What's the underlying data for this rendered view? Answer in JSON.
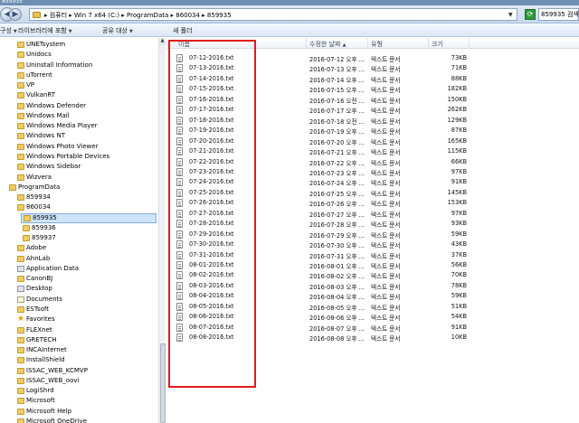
{
  "window": {
    "title": "859935"
  },
  "address": {
    "path": "▸ 컴퓨터 ▸ Win 7 x64 (C:) ▸ ProgramData ▸ 860034 ▸ 859935",
    "search_value": "859935 검색"
  },
  "toolbar": {
    "organize": "구성",
    "include_library": "라이브러리에 포함",
    "share_with": "공유 대상",
    "new_folder": "새 폴더"
  },
  "nav_items": [
    {
      "label": "UNETsystem",
      "indent": 1,
      "icon": "folder"
    },
    {
      "label": "Unidocs",
      "indent": 1,
      "icon": "folder"
    },
    {
      "label": "Uninstall Information",
      "indent": 1,
      "icon": "folder"
    },
    {
      "label": "uTorrent",
      "indent": 1,
      "icon": "folder"
    },
    {
      "label": "VP",
      "indent": 1,
      "icon": "folder"
    },
    {
      "label": "VulkanRT",
      "indent": 1,
      "icon": "folder"
    },
    {
      "label": "Windows Defender",
      "indent": 1,
      "icon": "folder"
    },
    {
      "label": "Windows Mail",
      "indent": 1,
      "icon": "folder"
    },
    {
      "label": "Windows Media Player",
      "indent": 1,
      "icon": "folder"
    },
    {
      "label": "Windows NT",
      "indent": 1,
      "icon": "folder"
    },
    {
      "label": "Windows Photo Viewer",
      "indent": 1,
      "icon": "folder"
    },
    {
      "label": "Windows Portable Devices",
      "indent": 1,
      "icon": "folder"
    },
    {
      "label": "Windows Sidebar",
      "indent": 1,
      "icon": "folder"
    },
    {
      "label": "Wizvera",
      "indent": 1,
      "icon": "folder"
    },
    {
      "label": "ProgramData",
      "indent": 0,
      "icon": "folder"
    },
    {
      "label": "859934",
      "indent": 1,
      "icon": "folder"
    },
    {
      "label": "860034",
      "indent": 1,
      "icon": "folder"
    },
    {
      "label": "859935",
      "indent": 2,
      "icon": "folder",
      "selected": true
    },
    {
      "label": "859936",
      "indent": 2,
      "icon": "folder"
    },
    {
      "label": "859937",
      "indent": 2,
      "icon": "folder"
    },
    {
      "label": "Adobe",
      "indent": 1,
      "icon": "folder"
    },
    {
      "label": "AhnLab",
      "indent": 1,
      "icon": "folder"
    },
    {
      "label": "Application Data",
      "indent": 1,
      "icon": "gear"
    },
    {
      "label": "CanonBJ",
      "indent": 1,
      "icon": "folder"
    },
    {
      "label": "Desktop",
      "indent": 1,
      "icon": "gear"
    },
    {
      "label": "Documents",
      "indent": 1,
      "icon": "docs"
    },
    {
      "label": "ESTsoft",
      "indent": 1,
      "icon": "folder"
    },
    {
      "label": "Favorites",
      "indent": 1,
      "icon": "star"
    },
    {
      "label": "FLEXnet",
      "indent": 1,
      "icon": "folder"
    },
    {
      "label": "GRETECH",
      "indent": 1,
      "icon": "folder"
    },
    {
      "label": "INCAInternet",
      "indent": 1,
      "icon": "folder"
    },
    {
      "label": "InstallShield",
      "indent": 1,
      "icon": "folder"
    },
    {
      "label": "ISSAC_WEB_KCMVP",
      "indent": 1,
      "icon": "folder"
    },
    {
      "label": "ISSAC_WEB_oovi",
      "indent": 1,
      "icon": "folder"
    },
    {
      "label": "LogiShrd",
      "indent": 1,
      "icon": "folder"
    },
    {
      "label": "Microsoft",
      "indent": 1,
      "icon": "folder"
    },
    {
      "label": "Microsoft Help",
      "indent": 1,
      "icon": "folder"
    },
    {
      "label": "Microsoft OneDrive",
      "indent": 1,
      "icon": "folder"
    }
  ],
  "columns": {
    "name": "이름",
    "date": "수정한 날짜",
    "type": "유형",
    "size": "크기"
  },
  "files": [
    {
      "name": "07-12-2016.txt",
      "date": "2016-07-12 오후 ...",
      "type": "텍스트 문서",
      "size": "73KB"
    },
    {
      "name": "07-13-2016.txt",
      "date": "2016-07-13 오후 ...",
      "type": "텍스트 문서",
      "size": "71KB"
    },
    {
      "name": "07-14-2016.txt",
      "date": "2016-07-14 오후 ...",
      "type": "텍스트 문서",
      "size": "88KB"
    },
    {
      "name": "07-15-2016.txt",
      "date": "2016-07-15 오후 ...",
      "type": "텍스트 문서",
      "size": "182KB"
    },
    {
      "name": "07-16-2016.txt",
      "date": "2016-07-16 오전 ...",
      "type": "텍스트 문서",
      "size": "150KB"
    },
    {
      "name": "07-17-2016.txt",
      "date": "2016-07-17 오후 ...",
      "type": "텍스트 문서",
      "size": "262KB"
    },
    {
      "name": "07-18-2016.txt",
      "date": "2016-07-18 오전 ...",
      "type": "텍스트 문서",
      "size": "129KB"
    },
    {
      "name": "07-19-2016.txt",
      "date": "2016-07-19 오후 ...",
      "type": "텍스트 문서",
      "size": "87KB"
    },
    {
      "name": "07-20-2016.txt",
      "date": "2016-07-20 오후 ...",
      "type": "텍스트 문서",
      "size": "165KB"
    },
    {
      "name": "07-21-2016.txt",
      "date": "2016-07-21 오후 ...",
      "type": "텍스트 문서",
      "size": "115KB"
    },
    {
      "name": "07-22-2016.txt",
      "date": "2016-07-22 오후 ...",
      "type": "텍스트 문서",
      "size": "66KB"
    },
    {
      "name": "07-23-2016.txt",
      "date": "2016-07-23 오후 ...",
      "type": "텍스트 문서",
      "size": "97KB"
    },
    {
      "name": "07-24-2016.txt",
      "date": "2016-07-24 오후 ...",
      "type": "텍스트 문서",
      "size": "91KB"
    },
    {
      "name": "07-25-2016.txt",
      "date": "2016-07-25 오후 ...",
      "type": "텍스트 문서",
      "size": "145KB"
    },
    {
      "name": "07-26-2016.txt",
      "date": "2016-07-26 오후 ...",
      "type": "텍스트 문서",
      "size": "153KB"
    },
    {
      "name": "07-27-2016.txt",
      "date": "2016-07-27 오후 ...",
      "type": "텍스트 문서",
      "size": "97KB"
    },
    {
      "name": "07-28-2016.txt",
      "date": "2016-07-28 오후 ...",
      "type": "텍스트 문서",
      "size": "93KB"
    },
    {
      "name": "07-29-2016.txt",
      "date": "2016-07-29 오후 ...",
      "type": "텍스트 문서",
      "size": "59KB"
    },
    {
      "name": "07-30-2016.txt",
      "date": "2016-07-30 오후 ...",
      "type": "텍스트 문서",
      "size": "43KB"
    },
    {
      "name": "07-31-2016.txt",
      "date": "2016-07-31 오후 ...",
      "type": "텍스트 문서",
      "size": "37KB"
    },
    {
      "name": "08-01-2016.txt",
      "date": "2016-08-01 오후 ...",
      "type": "텍스트 문서",
      "size": "56KB"
    },
    {
      "name": "08-02-2016.txt",
      "date": "2016-08-02 오후 ...",
      "type": "텍스트 문서",
      "size": "70KB"
    },
    {
      "name": "08-03-2016.txt",
      "date": "2016-08-03 오후 ...",
      "type": "텍스트 문서",
      "size": "78KB"
    },
    {
      "name": "08-04-2016.txt",
      "date": "2016-08-04 오후 ...",
      "type": "텍스트 문서",
      "size": "59KB"
    },
    {
      "name": "08-05-2016.txt",
      "date": "2016-08-05 오후 ...",
      "type": "텍스트 문서",
      "size": "51KB"
    },
    {
      "name": "08-06-2016.txt",
      "date": "2016-08-06 오후 ...",
      "type": "텍스트 문서",
      "size": "54KB"
    },
    {
      "name": "08-07-2016.txt",
      "date": "2016-08-07 오후 ...",
      "type": "텍스트 문서",
      "size": "91KB"
    },
    {
      "name": "08-08-2016.txt",
      "date": "2016-08-08 오후 ...",
      "type": "텍스트 문서",
      "size": "10KB"
    }
  ],
  "colors": {
    "highlight_box": "#e01b1b",
    "selection": "#cde3f7"
  }
}
